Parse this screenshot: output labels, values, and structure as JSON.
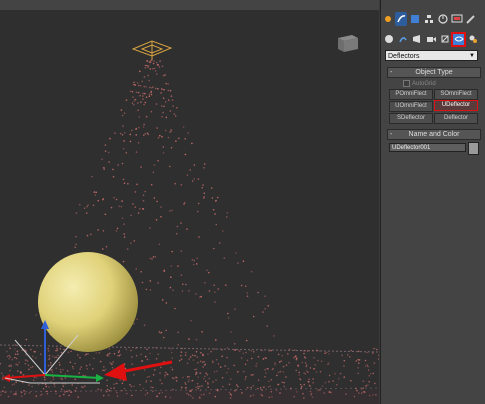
{
  "command_panel": {
    "tabs": [
      "sun-icon",
      "create-tab-icon",
      "modify-tab-icon",
      "hierarchy-tab-icon",
      "motion-tab-icon",
      "display-tab-icon",
      "utilities-tab-icon"
    ],
    "category_icons": [
      "sphere-icon",
      "shape-icon",
      "light-icon",
      "camera-icon",
      "helper-icon",
      "spacewarp-icon",
      "systems-icon"
    ],
    "dropdown_value": "Deflectors",
    "object_type": {
      "title": "Object Type",
      "autogrid_label": "AutoGrid",
      "buttons": [
        "POmniFlect",
        "SOmniFlect",
        "UOmniFlect",
        "UDeflector",
        "SDeflector",
        "Deflector"
      ],
      "active_button": "UDeflector"
    },
    "name_and_color": {
      "title": "Name and Color",
      "name_value": "UDeflector001",
      "swatch_color": "#9a9a9a"
    }
  },
  "colors": {
    "highlight": "#e01010",
    "sphere": "#e8dd88",
    "particles": "#d07070"
  }
}
